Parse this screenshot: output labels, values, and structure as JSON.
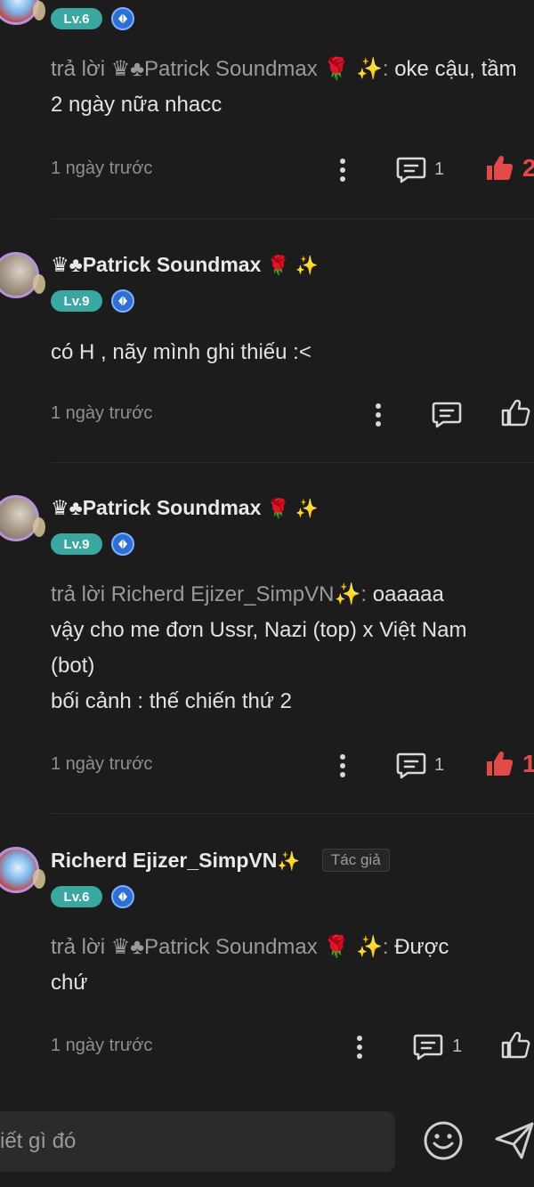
{
  "comments": [
    {
      "level": "Lv.6",
      "reply_prefix": "trả lời ♛♣Patrick Soundmax 🌹 ✨: ",
      "text": "oke cậu, tầm 2 ngày nữa nhacc",
      "time": "1 ngày trước",
      "reply_count": "1",
      "like_count": "2",
      "liked": true
    },
    {
      "name": "♛♣Patrick Soundmax",
      "name_emoji": "🌹 ✨",
      "level": "Lv.9",
      "text": "có H , nãy mình ghi thiếu :<",
      "time": "1 ngày trước",
      "reply_count": "",
      "like_count": "",
      "liked": false
    },
    {
      "name": "♛♣Patrick Soundmax",
      "name_emoji": "🌹 ✨",
      "level": "Lv.9",
      "reply_prefix": "trả lời Richerd Ejizer_SimpVN✨: ",
      "text": "oaaaaa vậy cho me đơn Ussr, Nazi (top) x Việt Nam (bot) bối cảnh : thế chiến thứ 2",
      "line1": "oaaaaa",
      "line2": "vậy cho me đơn Ussr, Nazi (top) x Việt Nam",
      "line3": "(bot)",
      "line4": "bối cảnh : thế chiến thứ 2",
      "time": "1 ngày trước",
      "reply_count": "1",
      "like_count": "1",
      "liked": true
    },
    {
      "name": "Richerd Ejizer_SimpVN",
      "name_emoji": "✨",
      "author_tag": "Tác giả",
      "level": "Lv.6",
      "reply_prefix": "trả lời ♛♣Patrick Soundmax 🌹 ✨: ",
      "text": "Được chứ",
      "line1": "Được",
      "line2": "chứ",
      "time": "1 ngày trước",
      "reply_count": "1",
      "like_count": "",
      "liked": false
    }
  ],
  "composer": {
    "placeholder": "iết gì đó"
  },
  "icons": {
    "reply": "comment-bubble-icon",
    "like": "thumbs-up-icon",
    "more": "more-vertical-icon",
    "emoji": "smiley-icon",
    "send": "send-icon",
    "rank": "diamond-rank-icon"
  },
  "colors": {
    "background": "#1c1c1c",
    "level_badge": "#3aa8a0",
    "like_active": "#e24a4a",
    "rank_badge": "#2d6fd3"
  }
}
